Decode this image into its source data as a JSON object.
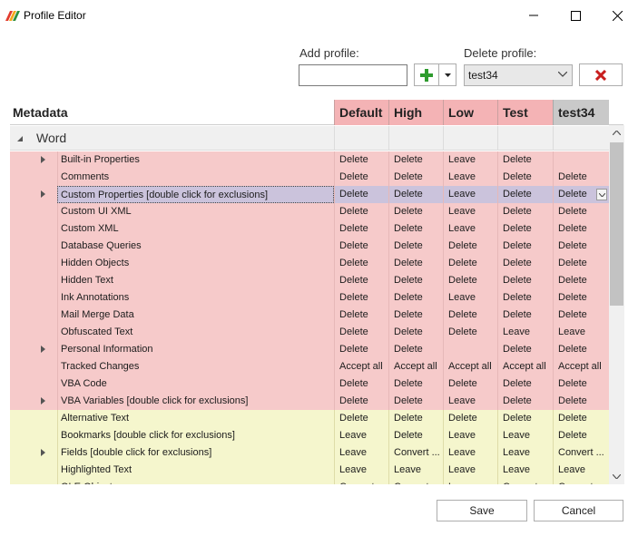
{
  "window": {
    "title": "Profile Editor"
  },
  "add_profile": {
    "label": "Add profile:",
    "value": ""
  },
  "delete_profile": {
    "label": "Delete profile:",
    "selected": "test34"
  },
  "grid": {
    "metadata_header": "Metadata",
    "profiles": [
      "Default",
      "High",
      "Low",
      "Test",
      "test34"
    ],
    "group": "Word",
    "rows": [
      {
        "name": "Built-in Properties",
        "expandable": true,
        "tone": "pink",
        "values": [
          "Delete",
          "Delete",
          "Leave",
          "Delete",
          ""
        ]
      },
      {
        "name": "Comments",
        "expandable": false,
        "tone": "pink",
        "values": [
          "Delete",
          "Delete",
          "Leave",
          "Delete",
          "Delete"
        ]
      },
      {
        "name": "Custom Properties [double click for exclusions]",
        "expandable": true,
        "tone": "pink",
        "selected": true,
        "values": [
          "Delete",
          "Delete",
          "Leave",
          "Delete",
          "Delete"
        ]
      },
      {
        "name": "Custom UI XML",
        "expandable": false,
        "tone": "pink",
        "values": [
          "Delete",
          "Delete",
          "Leave",
          "Delete",
          "Delete"
        ]
      },
      {
        "name": "Custom XML",
        "expandable": false,
        "tone": "pink",
        "values": [
          "Delete",
          "Delete",
          "Leave",
          "Delete",
          "Delete"
        ]
      },
      {
        "name": "Database Queries",
        "expandable": false,
        "tone": "pink",
        "values": [
          "Delete",
          "Delete",
          "Delete",
          "Delete",
          "Delete"
        ]
      },
      {
        "name": "Hidden Objects",
        "expandable": false,
        "tone": "pink",
        "values": [
          "Delete",
          "Delete",
          "Delete",
          "Delete",
          "Delete"
        ]
      },
      {
        "name": "Hidden Text",
        "expandable": false,
        "tone": "pink",
        "values": [
          "Delete",
          "Delete",
          "Delete",
          "Delete",
          "Delete"
        ]
      },
      {
        "name": "Ink Annotations",
        "expandable": false,
        "tone": "pink",
        "values": [
          "Delete",
          "Delete",
          "Leave",
          "Delete",
          "Delete"
        ]
      },
      {
        "name": "Mail Merge Data",
        "expandable": false,
        "tone": "pink",
        "values": [
          "Delete",
          "Delete",
          "Delete",
          "Delete",
          "Delete"
        ]
      },
      {
        "name": "Obfuscated Text",
        "expandable": false,
        "tone": "pink",
        "values": [
          "Delete",
          "Delete",
          "Delete",
          "Leave",
          "Leave"
        ]
      },
      {
        "name": "Personal Information",
        "expandable": true,
        "tone": "pink",
        "values": [
          "Delete",
          "Delete",
          "",
          "Delete",
          "Delete"
        ]
      },
      {
        "name": "Tracked Changes",
        "expandable": false,
        "tone": "pink",
        "values": [
          "Accept all",
          "Accept all",
          "Accept all",
          "Accept all",
          "Accept all"
        ]
      },
      {
        "name": "VBA Code",
        "expandable": false,
        "tone": "pink",
        "values": [
          "Delete",
          "Delete",
          "Delete",
          "Delete",
          "Delete"
        ]
      },
      {
        "name": "VBA Variables [double click for exclusions]",
        "expandable": true,
        "tone": "pink",
        "values": [
          "Delete",
          "Delete",
          "Leave",
          "Delete",
          "Delete"
        ]
      },
      {
        "name": "Alternative Text",
        "expandable": false,
        "tone": "yellow",
        "values": [
          "Delete",
          "Delete",
          "Delete",
          "Delete",
          "Delete"
        ]
      },
      {
        "name": "Bookmarks [double click for exclusions]",
        "expandable": false,
        "tone": "yellow",
        "values": [
          "Leave",
          "Delete",
          "Leave",
          "Leave",
          "Delete"
        ]
      },
      {
        "name": "Fields [double click for exclusions]",
        "expandable": true,
        "tone": "yellow",
        "values": [
          "Leave",
          "Convert ...",
          "Leave",
          "Leave",
          "Convert ..."
        ]
      },
      {
        "name": "Highlighted Text",
        "expandable": false,
        "tone": "yellow",
        "values": [
          "Leave",
          "Leave",
          "Leave",
          "Leave",
          "Leave"
        ]
      },
      {
        "name": "OLE Objects",
        "expandable": false,
        "tone": "yellow",
        "values": [
          "Convert ...",
          "Convert ...",
          "Leave",
          "Convert ...",
          "Convert ..."
        ]
      }
    ]
  },
  "buttons": {
    "save": "Save",
    "cancel": "Cancel"
  },
  "colors": {
    "pink_row": "#f6caca",
    "yellow_row": "#f5f6cd",
    "profile_header": "#f4b3b5",
    "selected_profile_header": "#c9c9c9",
    "add_icon": "#2e9b2e",
    "delete_icon": "#c81e1e"
  }
}
